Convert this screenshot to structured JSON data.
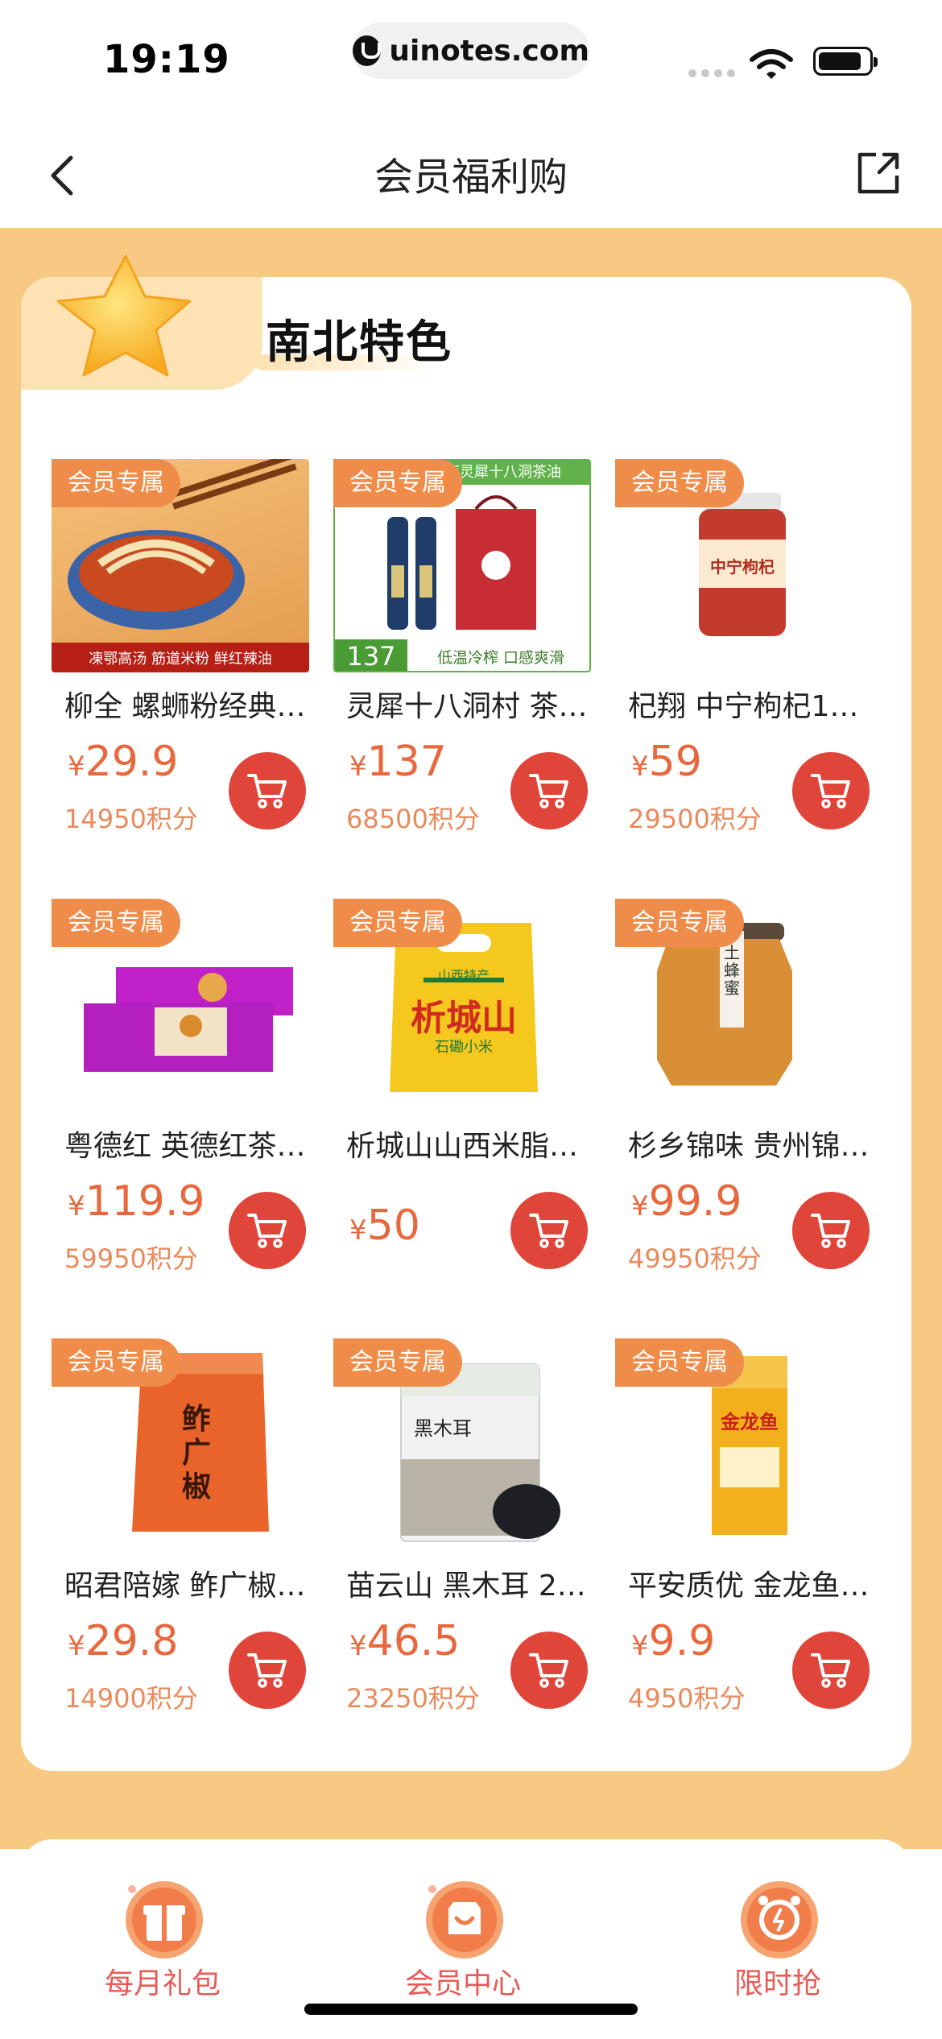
{
  "status_bar": {
    "time": "19:19",
    "url": "uinotes.com"
  },
  "nav": {
    "title": "会员福利购"
  },
  "section": {
    "title": "南北特色"
  },
  "colors": {
    "accent": "#e0453a",
    "price": "#e8683d",
    "badge": "#f08c4a",
    "page_bg": "#f7c983"
  },
  "products": [
    {
      "badge": "会员专属",
      "name": "柳全 螺蛳粉经典…",
      "currency": "¥",
      "price": "29.9",
      "points": "14950积分"
    },
    {
      "badge": "会员专属",
      "name": "灵犀十八洞村 茶…",
      "currency": "¥",
      "price": "137",
      "points": "68500积分"
    },
    {
      "badge": "会员专属",
      "name": "杞翔 中宁枸杞13…",
      "currency": "¥",
      "price": "59",
      "points": "29500积分"
    },
    {
      "badge": "会员专属",
      "name": "粤德红 英德红茶…",
      "currency": "¥",
      "price": "119.9",
      "points": "59950积分"
    },
    {
      "badge": "会员专属",
      "name": "析城山山西米脂…",
      "currency": "¥",
      "price": "50",
      "points": ""
    },
    {
      "badge": "会员专属",
      "name": "杉乡锦味 贵州锦…",
      "currency": "¥",
      "price": "99.9",
      "points": "49950积分"
    },
    {
      "badge": "会员专属",
      "name": "昭君陪嫁 鲊广椒…",
      "currency": "¥",
      "price": "29.8",
      "points": "14900积分"
    },
    {
      "badge": "会员专属",
      "name": "苗云山 黑木耳 2…",
      "currency": "¥",
      "price": "46.5",
      "points": "23250积分"
    },
    {
      "badge": "会员专属",
      "name": "平安质优 金龙鱼…",
      "currency": "¥",
      "price": "9.9",
      "points": "4950积分"
    }
  ],
  "product_images": {
    "p1_tagline": "凍鄂高汤 筋道米粉 鲜红辣油",
    "p2_banner": "湖南灵犀十八洞茶油",
    "p2_price_tag": "137",
    "p2_caption": "低温冷榨 口感爽滑",
    "p3_label": "中宁枸杞",
    "p5_brand": "析城山",
    "p5_top": "山西特产",
    "p5_sub": "石磡小米",
    "p6_label": "土蜂蜜",
    "p7_label": "鲊广椒",
    "p8_label": "黑木耳",
    "p9_label": "金龙鱼"
  },
  "tabbar": [
    {
      "label": "每月礼包",
      "icon": "gift-icon"
    },
    {
      "label": "会员中心",
      "icon": "member-center-icon"
    },
    {
      "label": "限时抢",
      "icon": "alarm-clock-icon"
    }
  ]
}
